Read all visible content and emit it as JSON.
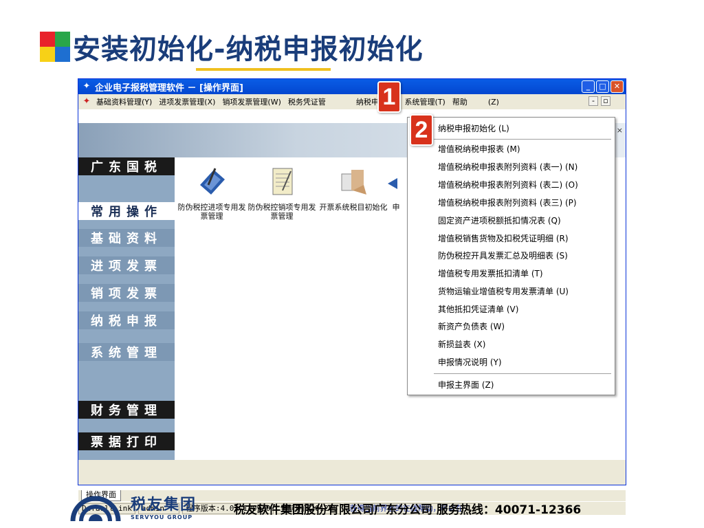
{
  "slide": {
    "title": "安装初始化-纳税申报初始化",
    "logo_colors": [
      "#e8222a",
      "#29a64a",
      "#f7d117",
      "#1e6fd1"
    ]
  },
  "window": {
    "title": "企业电子报税管理软件 － [操作界面]",
    "controls": {
      "minimize": "_",
      "maximize": "□",
      "close": "✕"
    }
  },
  "menubar": {
    "items": [
      "基础资料管理(Y)",
      "进项发票管理(X)",
      "销项发票管理(W)",
      "税务凭证管",
      "纳税申报(U)",
      "系统管理(T)",
      "帮助",
      "(Z)"
    ],
    "mdi_controls": [
      "-",
      "▫"
    ]
  },
  "banner": {
    "close": "×"
  },
  "sidebar": {
    "items": [
      "广东国税",
      "常用操作",
      "基础资料",
      "进项发票",
      "销项发票",
      "纳税申报",
      "系统管理",
      "财务管理",
      "票据打印"
    ]
  },
  "tiles": [
    {
      "label": "防伪税控进项专用发票管理",
      "icon": "pen-document-icon"
    },
    {
      "label": "防伪税控销项专用发票管理",
      "icon": "notepad-icon"
    },
    {
      "label": "开票系统税目初始化",
      "icon": "document-hand-icon"
    },
    {
      "label": "申",
      "icon": "partial-icon"
    }
  ],
  "dropdown": {
    "items": [
      "纳税申报初始化 (L)",
      "增值税纳税申报表 (M)",
      "增值税纳税申报表附列资料 (表一) (N)",
      "增值税纳税申报表附列资料 (表二) (O)",
      "增值税纳税申报表附列资料 (表三) (P)",
      "固定资产进项税额抵扣情况表 (Q)",
      "增值税销售货物及扣税凭证明细 (R)",
      "防伪税控开具发票汇总及明细表 (S)",
      "增值税专用发票抵扣清单 (T)",
      "货物运输业增值税专用发票清单 (U)",
      "其他抵扣凭证清单 (V)",
      "新资产负债表 (W)",
      "新损益表 (X)",
      "申报情况说明 (Y)",
      "申报主界面 (Z)"
    ]
  },
  "badges": {
    "step1": "1",
    "step2": "2"
  },
  "tabbar": {
    "tab": "操作界面"
  },
  "statusbar": {
    "link": "DefaultLink",
    "user": "admin",
    "version": "程序版本:4.03-120920",
    "period": "当前期间201208",
    "help": ",获得当前界面的在线帮助，可以在"
  },
  "footer": {
    "brand_cn": "税友集团",
    "brand_en": "SERVYOU GROUP",
    "text": "税友软件集团股份有限公司广东分公司   服务热线：40071-12366"
  }
}
